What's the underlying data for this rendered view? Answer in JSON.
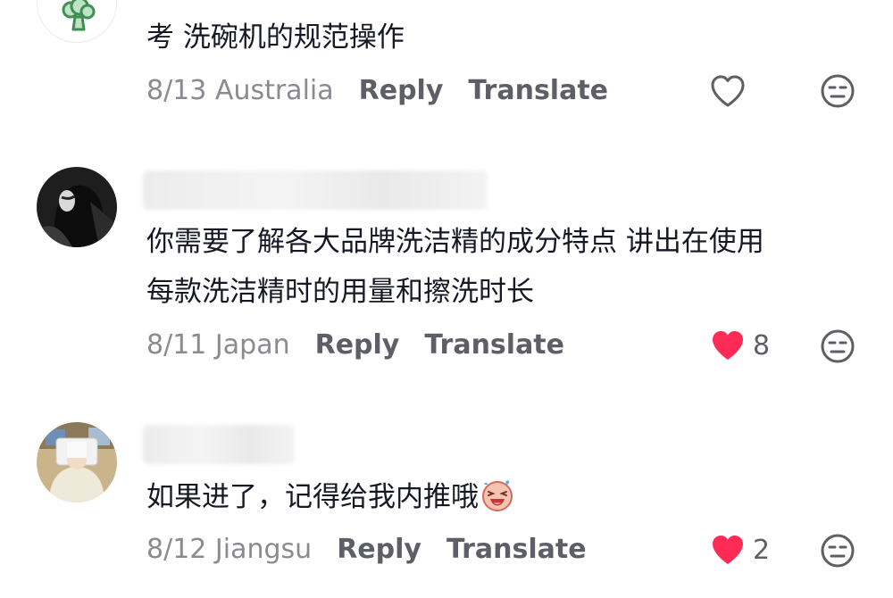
{
  "comments": [
    {
      "avatar_icon": "broccoli-icon",
      "text_lines": [
        "考 洗碗机的规范操作"
      ],
      "date": "8/13",
      "location": "Australia",
      "reply_label": "Reply",
      "translate_label": "Translate",
      "liked": false,
      "like_count": ""
    },
    {
      "avatar_icon": "user-photo",
      "text_lines": [
        "你需要了解各大品牌洗洁精的成分特点 讲出在使用",
        "每款洗洁精时的用量和擦洗时长"
      ],
      "date": "8/11",
      "location": "Japan",
      "reply_label": "Reply",
      "translate_label": "Translate",
      "liked": true,
      "like_count": "8"
    },
    {
      "avatar_icon": "user-photo",
      "text_lines": [
        "如果进了，记得给我内推哦"
      ],
      "emoji": "laughing-emoji-sticker",
      "date": "8/12",
      "location": "Jiangsu",
      "reply_label": "Reply",
      "translate_label": "Translate",
      "liked": true,
      "like_count": "2"
    }
  ],
  "colors": {
    "like_red": "#fe2c55",
    "meta_grey": "#8a8b91",
    "action_grey": "#5e5f66",
    "text": "#161823"
  }
}
